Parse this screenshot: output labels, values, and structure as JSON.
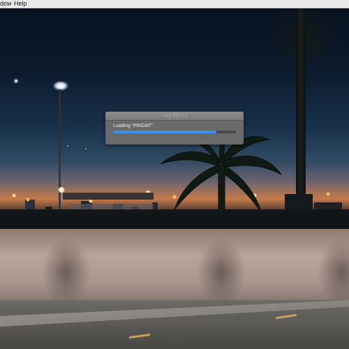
{
  "menubar": {
    "items": [
      "dow",
      "Help"
    ]
  },
  "dialog": {
    "title": "Lazy Bot 1.1",
    "message": "Loading “FRIDAY”",
    "progress": 0.84,
    "accent_color": "#3c8ff0"
  }
}
